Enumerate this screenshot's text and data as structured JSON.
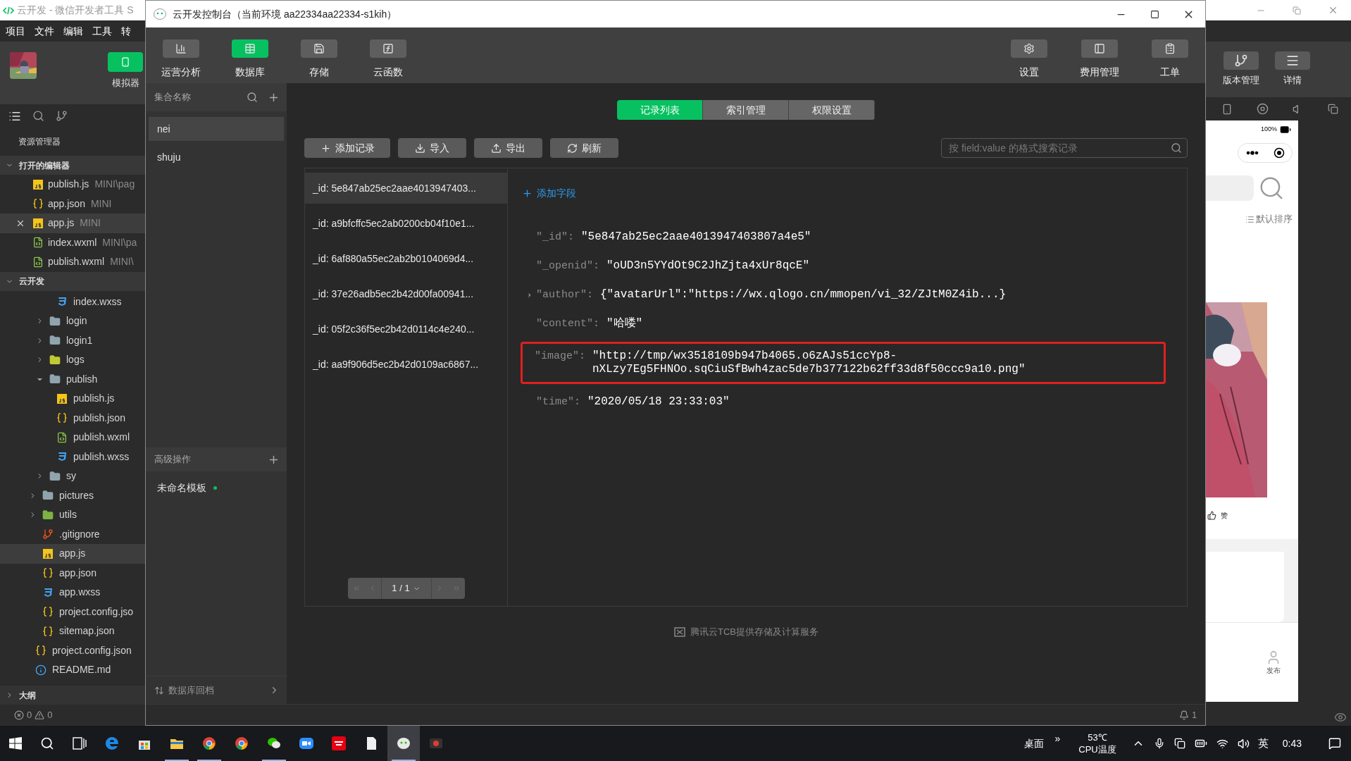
{
  "ide_window": {
    "title": "云开发 - 微信开发者工具 S",
    "menu": [
      "项目",
      "文件",
      "编辑",
      "工具",
      "转"
    ],
    "simulator_button": {
      "label": "模拟器",
      "selected": true
    },
    "explorer_title": "资源管理器",
    "open_editors": {
      "label": "打开的编辑器",
      "expanded": true,
      "items": [
        {
          "name": "publish.js",
          "path": "MINI\\pag",
          "kind": "js",
          "selected": false
        },
        {
          "name": "app.json",
          "path": "MINI",
          "kind": "json",
          "selected": false
        },
        {
          "name": "app.js",
          "path": "MINI",
          "kind": "js",
          "selected": true
        },
        {
          "name": "index.wxml",
          "path": "MINI\\pa",
          "kind": "wxml",
          "selected": false
        },
        {
          "name": "publish.wxml",
          "path": "MINI\\",
          "kind": "wxml",
          "selected": false
        }
      ]
    },
    "project": {
      "label": "云开发",
      "expanded": true,
      "tree": [
        {
          "children": [
            {
              "children": [
                {
                  "children": [
                    {
                      "name": "index.wxss",
                      "kind": "wxss",
                      "selected": false
                    }
                  ]
                },
                {
                  "name": "login",
                  "kind": "folder",
                  "color": "#90a4ae",
                  "expanded": false,
                  "selected": false
                },
                {
                  "name": "login1",
                  "kind": "folder",
                  "color": "#90a4ae",
                  "expanded": false,
                  "selected": false
                },
                {
                  "name": "logs",
                  "kind": "folder",
                  "color": "#c0ca33",
                  "expanded": false,
                  "selected": false
                },
                {
                  "name": "publish",
                  "kind": "folder",
                  "color": "#90a4ae",
                  "expanded": true,
                  "selected": false,
                  "children": [
                    {
                      "name": "publish.js",
                      "kind": "js",
                      "selected": false
                    },
                    {
                      "name": "publish.json",
                      "kind": "json",
                      "selected": false
                    },
                    {
                      "name": "publish.wxml",
                      "kind": "wxml",
                      "selected": false
                    },
                    {
                      "name": "publish.wxss",
                      "kind": "wxss",
                      "selected": false
                    }
                  ]
                },
                {
                  "name": "sy",
                  "kind": "folder",
                  "color": "#90a4ae",
                  "expanded": false,
                  "selected": false
                }
              ]
            },
            {
              "name": "pictures",
              "kind": "folder",
              "color": "#90a4ae",
              "expanded": false,
              "selected": false
            },
            {
              "name": "utils",
              "kind": "folder",
              "color": "#7cb342",
              "expanded": false,
              "selected": false
            },
            {
              "name": ".gitignore",
              "kind": "git",
              "selected": false
            },
            {
              "name": "app.js",
              "kind": "js",
              "selected": true
            },
            {
              "name": "app.json",
              "kind": "json",
              "selected": false
            },
            {
              "name": "app.wxss",
              "kind": "wxss",
              "selected": false
            },
            {
              "name": "project.config.jso",
              "kind": "json",
              "selected": false
            },
            {
              "name": "sitemap.json",
              "kind": "json",
              "selected": false
            }
          ]
        },
        {
          "name": "project.config.json",
          "kind": "json",
          "selected": false
        },
        {
          "name": "README.md",
          "kind": "info",
          "selected": false
        }
      ]
    },
    "outline": {
      "label": "大纲",
      "expanded": false
    },
    "status": {
      "errors": "0",
      "warnings": "0"
    }
  },
  "console_window": {
    "title": "云开发控制台（当前环境 aa22334aa22334-s1kih）",
    "nav_left": [
      {
        "label": "运营分析",
        "kind": "chart",
        "selected": false
      },
      {
        "label": "数据库",
        "kind": "database",
        "selected": true
      },
      {
        "label": "存储",
        "kind": "storage",
        "selected": false
      },
      {
        "label": "云函数",
        "kind": "function",
        "selected": false
      }
    ],
    "nav_right": [
      {
        "label": "设置",
        "kind": "settings",
        "selected": false
      },
      {
        "label": "费用管理",
        "kind": "billing",
        "selected": false
      },
      {
        "label": "工单",
        "kind": "ticket",
        "selected": false
      }
    ],
    "collections": {
      "header": "集合名称",
      "items": [
        {
          "name": "nei",
          "selected": true
        },
        {
          "name": "shuju",
          "selected": false
        }
      ]
    },
    "advanced": {
      "header": "高级操作",
      "items": [
        {
          "name": "未命名模板",
          "color": "#07c160"
        }
      ]
    },
    "rollback": "数据库回档",
    "tabs": [
      {
        "label": "记录列表",
        "selected": true
      },
      {
        "label": "索引管理",
        "selected": false
      },
      {
        "label": "权限设置",
        "selected": false
      }
    ],
    "actions": [
      {
        "label": "添加记录",
        "kind": "add"
      },
      {
        "label": "导入",
        "kind": "import"
      },
      {
        "label": "导出",
        "kind": "export"
      },
      {
        "label": "刷新",
        "kind": "refresh"
      }
    ],
    "search": {
      "placeholder": "按 field:value 的格式搜索记录"
    },
    "records": [
      {
        "id": "_id: 5e847ab25ec2aae4013947403...",
        "selected": true
      },
      {
        "id": "_id: a9bfcffc5ec2ab0200cb04f10e1...",
        "selected": false
      },
      {
        "id": "_id: 6af880a55ec2ab2b0104069d4...",
        "selected": false
      },
      {
        "id": "_id: 37e26adb5ec2b42d00fa00941...",
        "selected": false
      },
      {
        "id": "_id: 05f2c36f5ec2b42d0114c4e240...",
        "selected": false
      },
      {
        "id": "_id: aa9f906d5ec2b42d0109ac6867...",
        "selected": false
      }
    ],
    "pagination": "1 / 1",
    "add_field": "添加字段",
    "fields": [
      {
        "key": "\"_id\":",
        "value": "\"5e847ab25ec2aae4013947403807a4e5\"",
        "highlighted": false
      },
      {
        "key": "\"_openid\":",
        "value": "\"oUD3n5YYdOt9C2JhZjta4xUr8qcE\"",
        "highlighted": false
      },
      {
        "key": "\"author\":",
        "value": "{\"avatarUrl\":\"https://wx.qlogo.cn/mmopen/vi_32/ZJtM0Z4ib...}",
        "expanded": false,
        "highlighted": false
      },
      {
        "key": "\"content\":",
        "value": "\"哈喽\"",
        "highlighted": false
      },
      {
        "key": "\"image\":",
        "value": "\"http://tmp/wx3518109b947b4065.o6zAJs51ccYp8-nXLzy7Eg5FHNOo.sqCiuSfBwh4zac5de7b377122b62ff33d8f50ccc9a10.png\"",
        "highlighted": true
      },
      {
        "key": "\"time\":",
        "value": "\"2020/05/18 23:33:03\"",
        "highlighted": false
      }
    ],
    "footer": "腾讯云TCB提供存储及计算服务",
    "notifications": "1"
  },
  "right_panel": {
    "toolbar": [
      {
        "label": "版本管理",
        "kind": "version"
      },
      {
        "label": "详情",
        "kind": "details"
      }
    ],
    "phone": {
      "battery": "100%",
      "sort": "默认排序",
      "like": "赞",
      "tab": "发布"
    }
  },
  "taskbar": {
    "apps": [
      {
        "kind": "edge",
        "running": false,
        "selected": false
      },
      {
        "kind": "store",
        "running": false,
        "selected": false
      },
      {
        "kind": "explorer",
        "running": true,
        "selected": false
      },
      {
        "kind": "chrome",
        "running": true,
        "selected": false
      },
      {
        "kind": "chrome",
        "running": false,
        "selected": false
      },
      {
        "kind": "wechat",
        "running": true,
        "selected": false
      },
      {
        "kind": "zoom",
        "running": false,
        "selected": false
      },
      {
        "kind": "youdao",
        "running": false,
        "selected": false
      },
      {
        "kind": "notes",
        "running": false,
        "selected": false
      },
      {
        "kind": "devtools",
        "running": true,
        "selected": true
      },
      {
        "kind": "recorder",
        "running": false,
        "selected": false
      }
    ],
    "desktop": "桌面",
    "more": "»",
    "temperature": "53℃",
    "temperature_label": "CPU温度",
    "ime": "英",
    "time": "0:43"
  }
}
